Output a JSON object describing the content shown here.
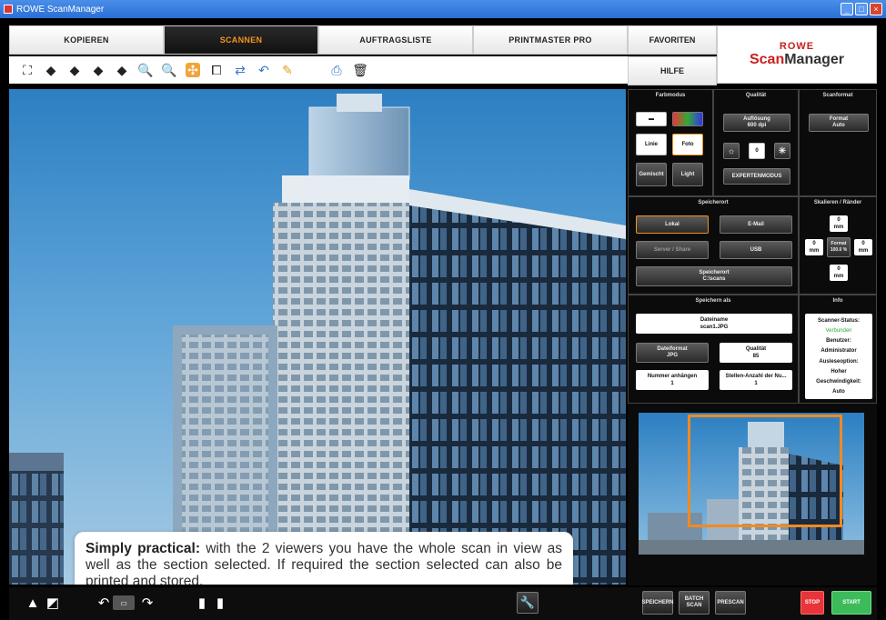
{
  "window": {
    "title": "ROWE ScanManager"
  },
  "tabs": [
    {
      "label": "KOPIEREN"
    },
    {
      "label": "SCANNEN"
    },
    {
      "label": "AUFTRAGSLISTE"
    },
    {
      "label": "PRINTMASTER PRO"
    }
  ],
  "side_buttons": {
    "favoriten": "FAVORITEN",
    "hilfe": "HILFE"
  },
  "logo": {
    "brand": "ROWE",
    "product_scan": "Scan",
    "product_rest": "Manager"
  },
  "toolbar_icons": [
    "fit-page-icon",
    "arrow-left-icon",
    "arrow-right-icon",
    "arrow-up-icon",
    "arrow-down-icon",
    "zoom-in-icon",
    "zoom-out-icon",
    "select-area-icon",
    "crop-icon",
    "mirror-icon",
    "undo-icon",
    "highlight-icon",
    "print-icon",
    "delete-icon"
  ],
  "caption": {
    "lead": "Simply practical:",
    "text": " with the 2 viewers you have the whole scan in view as well as the section selected. If required the section selected can also be printed and stored."
  },
  "panel": {
    "farbmodus": {
      "title": "Farbmodus",
      "linie": "Linie",
      "foto": "Foto",
      "gemischt": "Gemischt",
      "light": "Light"
    },
    "qualitaet": {
      "title": "Qualität",
      "aufloesung_label": "Auflösung",
      "aufloesung_value": "600 dpi",
      "value": "0",
      "expertenmodus": "EXPERTENMODUS"
    },
    "scanformat": {
      "title": "Scanformat",
      "label": "Format",
      "value": "Auto"
    },
    "speicherort": {
      "title": "Speicherort",
      "lokal": "Lokal",
      "email": "E-Mail",
      "server": "Server / Share",
      "usb": "USB",
      "path_label": "Speicherort",
      "path_value": "C:\\scans"
    },
    "skalieren": {
      "title": "Skalieren / Ränder",
      "top": "0",
      "left": "0",
      "right": "0",
      "bottom": "0",
      "unit": "mm",
      "center_label": "Format",
      "center_value": "100.0 %"
    },
    "speichern_als": {
      "title": "Speichern als",
      "dateiname_label": "Dateiname",
      "dateiname_value": "scan1.JPG",
      "dateiformat_label": "Dateiformat",
      "dateiformat_value": "JPG",
      "qualitaet_label": "Qualität",
      "qualitaet_value": "85",
      "nummer_label": "Nummer anhängen",
      "nummer_value": "1",
      "stellen_label": "Stellen-Anzahl der Nu...",
      "stellen_value": "1"
    },
    "info": {
      "title": "Info",
      "scanner_status_label": "Scanner-Status:",
      "scanner_status_value": "Verbunden",
      "benutzer_label": "Benutzer:",
      "benutzer_value": "Administrator",
      "ausleseoption_label": "Ausleseoption:",
      "ausleseoption_value": "Hoher",
      "geschwindigkeit_label": "Geschwindigkeit:",
      "geschwindigkeit_value": "Auto"
    }
  },
  "bottom": {
    "speichern": "SPEICHERN",
    "batch_scan": "BATCH SCAN",
    "prescan": "PRESCAN",
    "stop": "STOP",
    "start": "START"
  },
  "colors": {
    "accent": "#f29320",
    "stop": "#e8343a",
    "start": "#3dbb5a",
    "brand": "#c8201f"
  }
}
